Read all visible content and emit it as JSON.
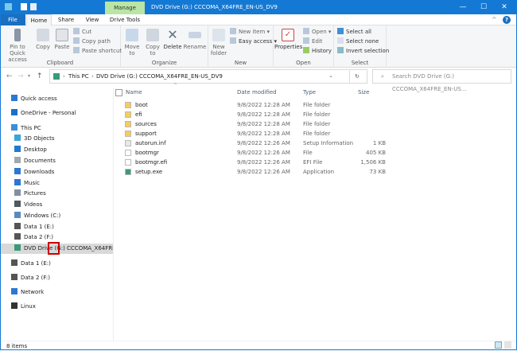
{
  "window": {
    "title": "DVD Drive (G:) CCCOMA_X64FRE_EN-US_DV9",
    "context_tab": "Manage",
    "minimize": "—",
    "maximize": "☐",
    "close": "✕"
  },
  "tabs": [
    "File",
    "Home",
    "Share",
    "View",
    "Drive Tools"
  ],
  "ribbon": {
    "clipboard": {
      "label": "Clipboard",
      "pin": "Pin to Quick access",
      "copy": "Copy",
      "paste": "Paste",
      "cut": "Cut",
      "copy_path": "Copy path",
      "paste_shortcut": "Paste shortcut"
    },
    "organize": {
      "label": "Organize",
      "move_to": "Move to",
      "copy_to": "Copy to",
      "delete": "Delete",
      "rename": "Rename"
    },
    "new": {
      "label": "New",
      "new_folder": "New folder",
      "new_item": "New item ▾",
      "easy_access": "Easy access ▾"
    },
    "open": {
      "label": "Open",
      "properties": "Properties",
      "open": "Open ▾",
      "edit": "Edit",
      "history": "History"
    },
    "select": {
      "label": "Select",
      "select_all": "Select all",
      "select_none": "Select none",
      "invert": "Invert selection"
    }
  },
  "address": {
    "crumbs": [
      "This PC",
      "DVD Drive (G:) CCCOMA_X64FRE_EN-US_DV9"
    ],
    "search_placeholder": "Search DVD Drive (G:) CCCOMA_X64FRE_EN-US..."
  },
  "columns": {
    "name": "Name",
    "date": "Date modified",
    "type": "Type",
    "size": "Size"
  },
  "files": [
    {
      "name": "boot",
      "date": "9/8/2022 12:28 AM",
      "type": "File folder",
      "size": "",
      "icon": "folder"
    },
    {
      "name": "efi",
      "date": "9/8/2022 12:28 AM",
      "type": "File folder",
      "size": "",
      "icon": "folder"
    },
    {
      "name": "sources",
      "date": "9/8/2022 12:28 AM",
      "type": "File folder",
      "size": "",
      "icon": "folder"
    },
    {
      "name": "support",
      "date": "9/8/2022 12:28 AM",
      "type": "File folder",
      "size": "",
      "icon": "folder"
    },
    {
      "name": "autorun.inf",
      "date": "9/8/2022 12:26 AM",
      "type": "Setup Information",
      "size": "1 KB",
      "icon": "settings-file"
    },
    {
      "name": "bootmgr",
      "date": "9/8/2022 12:26 AM",
      "type": "File",
      "size": "405 KB",
      "icon": "file"
    },
    {
      "name": "bootmgr.efi",
      "date": "9/8/2022 12:26 AM",
      "type": "EFI File",
      "size": "1,506 KB",
      "icon": "file"
    },
    {
      "name": "setup.exe",
      "date": "9/8/2022 12:26 AM",
      "type": "Application",
      "size": "73 KB",
      "icon": "setup"
    }
  ],
  "sidebar": [
    {
      "label": "Quick access",
      "icon": "star",
      "color": "#2b78d0"
    },
    {
      "label": "OneDrive - Personal",
      "icon": "cloud",
      "color": "#1b6fc8"
    },
    {
      "label": "This PC",
      "icon": "monitor",
      "color": "#3c8fd8"
    },
    {
      "label": "3D Objects",
      "icon": "cube",
      "color": "#39a6d8"
    },
    {
      "label": "Desktop",
      "icon": "desktop",
      "color": "#1f7ad0"
    },
    {
      "label": "Documents",
      "icon": "document",
      "color": "#a0a8b0"
    },
    {
      "label": "Downloads",
      "icon": "download",
      "color": "#2b78d0"
    },
    {
      "label": "Music",
      "icon": "music",
      "color": "#2b78d0"
    },
    {
      "label": "Pictures",
      "icon": "picture",
      "color": "#8090a0"
    },
    {
      "label": "Videos",
      "icon": "video",
      "color": "#505860"
    },
    {
      "label": "Windows (C:)",
      "icon": "drive-windows",
      "color": "#5a8ac0"
    },
    {
      "label": "Data 1 (E:)",
      "icon": "drive",
      "color": "#555"
    },
    {
      "label": "Data 2 (F:)",
      "icon": "drive",
      "color": "#555"
    },
    {
      "label": "DVD Drive (G:) CCCOMA_X64FRE_EN-US_DV9",
      "icon": "dvd",
      "color": "#3a9a7a",
      "selected": true
    },
    {
      "label": "Data 1 (E:)",
      "icon": "drive",
      "color": "#555"
    },
    {
      "label": "Data 2 (F:)",
      "icon": "drive",
      "color": "#555"
    },
    {
      "label": "Network",
      "icon": "network",
      "color": "#2b78d0"
    },
    {
      "label": "Linux",
      "icon": "penguin",
      "color": "#333"
    }
  ],
  "status": {
    "items": "8 items"
  },
  "colors": {
    "titlebar": "#1479d4",
    "manage": "#b9e6a6",
    "highlight": "#cc0000",
    "selected": "#d9d9d9"
  }
}
